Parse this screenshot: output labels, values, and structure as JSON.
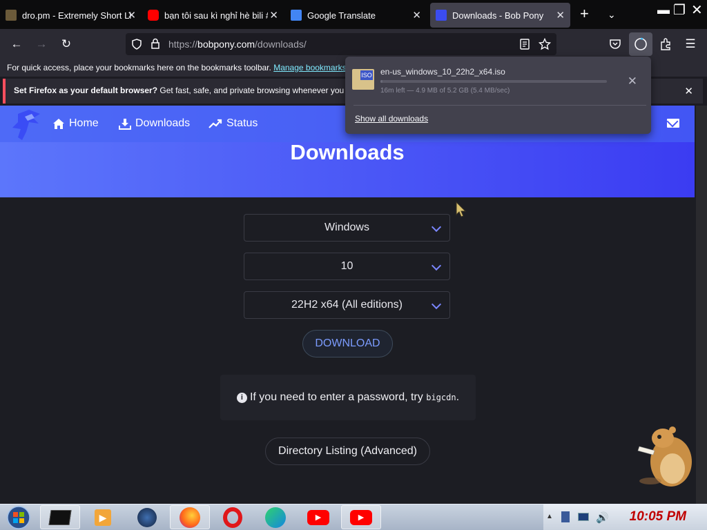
{
  "tabs": [
    {
      "title": "dro.pm - Extremely Short Li",
      "favicon": "dro-favicon",
      "active": false
    },
    {
      "title": "bạn tôi sau kì nghỉ hè bili #",
      "favicon": "youtube-favicon",
      "active": false
    },
    {
      "title": "Google Translate",
      "favicon": "google-translate-favicon",
      "active": false
    },
    {
      "title": "Downloads - Bob Pony",
      "favicon": "bobpony-favicon",
      "active": true
    }
  ],
  "url": {
    "prefix": "https://",
    "domain": "bobpony.com",
    "path": "/downloads/"
  },
  "bookmarks_bar": {
    "text": "For quick access, place your bookmarks here on the bookmarks toolbar.",
    "link": "Manage bookmarks..."
  },
  "notice": {
    "bold": "Set Firefox as your default browser?",
    "text": "Get fast, safe, and private browsing whenever you use the web."
  },
  "site_nav": {
    "items": [
      {
        "label": "Home",
        "icon": "home-icon"
      },
      {
        "label": "Downloads",
        "icon": "download-icon"
      },
      {
        "label": "Status",
        "icon": "trend-icon"
      }
    ]
  },
  "hero": {
    "title": "Downloads"
  },
  "selects": [
    {
      "value": "Windows"
    },
    {
      "value": "10"
    },
    {
      "value": "22H2 x64 (All editions)"
    }
  ],
  "download_button": "DOWNLOAD",
  "info": {
    "text": "If you need to enter a password, try",
    "code": "bigcdn",
    "end": "."
  },
  "dir_button": "Directory Listing (Advanced)",
  "download_panel": {
    "filename": "en-us_windows_10_22h2_x64.iso",
    "status": "16m left — 4.9 MB of 5.2 GB (5.4 MB/sec)",
    "progress_pct": 0.1,
    "show_all": "Show all downloads"
  },
  "clock": "10:05 PM",
  "colors": {
    "accent": "#4856f5",
    "active_tab": "#42414d",
    "page_bg": "#1c1d23",
    "clock": "#c00000"
  }
}
